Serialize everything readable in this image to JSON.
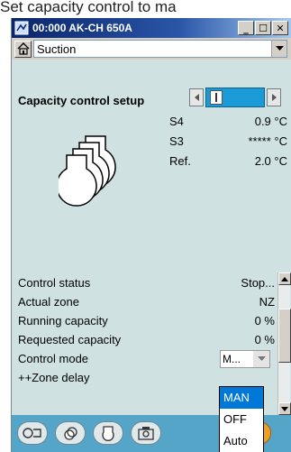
{
  "caption": "Set capacity control to ma",
  "window": {
    "title": "00:000 AK-CH 650A",
    "minimize_glyph": "_",
    "maximize_glyph": "☐",
    "close_glyph": "✕"
  },
  "view_selector": {
    "value": "Suction",
    "home_icon": "home-icon",
    "arrow_icon": "dropdown-arrow-icon"
  },
  "section": {
    "title": "Capacity control setup"
  },
  "readings": [
    {
      "name": "S4",
      "value": "0.9 °C"
    },
    {
      "name": "S3",
      "value": "***** °C"
    },
    {
      "name": "Ref.",
      "value": "2.0 °C"
    }
  ],
  "params": [
    {
      "label": "Control status",
      "value": "Stop..."
    },
    {
      "label": "Actual zone",
      "value": "NZ"
    },
    {
      "label": "Running capacity",
      "value": "0 %"
    },
    {
      "label": "Requested capacity",
      "value": "0 %"
    },
    {
      "label": "Control mode",
      "value": "M..."
    },
    {
      "label": "++Zone delay",
      "value": ""
    }
  ],
  "control_mode_options": [
    "MAN",
    "OFF",
    "Auto"
  ],
  "toolbar": [
    "overview-icon",
    "compressor-group-icon",
    "compressor-icon",
    "settings-icon",
    "alarm-icon"
  ]
}
